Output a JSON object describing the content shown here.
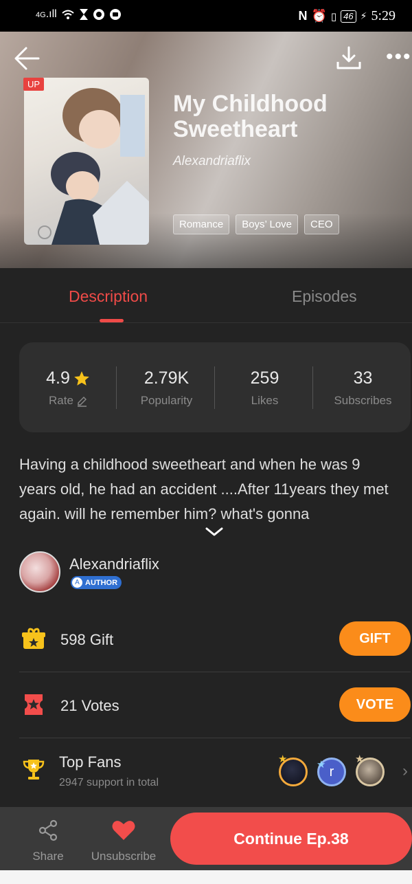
{
  "status_bar": {
    "network": "4G",
    "battery": "46",
    "time": "5:29"
  },
  "header": {
    "up_badge": "UP",
    "title": "My Childhood Sweetheart",
    "author": "Alexandriaflix",
    "tags": [
      "Romance",
      "Boys’ Love",
      "CEO"
    ],
    "more_label": "•••"
  },
  "tabs": {
    "description": "Description",
    "episodes": "Episodes",
    "active": "description",
    "accent_color": "#ef4b48"
  },
  "stats": [
    {
      "value": "4.9",
      "label": "Rate"
    },
    {
      "value": "2.79K",
      "label": "Popularity"
    },
    {
      "value": "259",
      "label": "Likes"
    },
    {
      "value": "33",
      "label": "Subscribes"
    }
  ],
  "description": "Having a childhood sweetheart and when he was 9 years old, he had an accident ....After 11years they met again. will he remember him? what's gonna",
  "author": {
    "name": "Alexandriaflix",
    "badge": "AUTHOR",
    "badge_icon": "A"
  },
  "gift": {
    "count": "598",
    "label": "Gift",
    "button": "GIFT"
  },
  "vote": {
    "count": "21",
    "label": "Votes",
    "button": "VOTE"
  },
  "fans": {
    "title": "Top Fans",
    "subtitle": "2947 support in total",
    "fan2_initial": "r",
    "chevron": "›"
  },
  "bottom_bar": {
    "share": "Share",
    "unsubscribe": "Unsubscribe",
    "continue": "Continue Ep.38"
  },
  "colors": {
    "accent_red": "#f24d4b",
    "accent_orange": "#fb8c1a",
    "background": "#232323"
  }
}
